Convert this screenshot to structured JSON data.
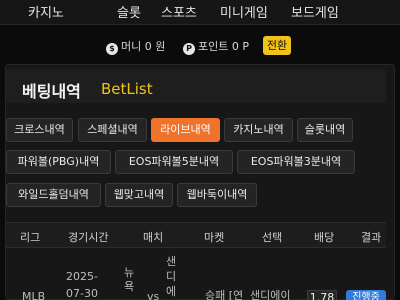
{
  "top_nav": [
    "카지노",
    "슬롯",
    "스포츠",
    "미니게임",
    "보드게임"
  ],
  "money": {
    "money_icon": "$",
    "money_label": "머니 0 원",
    "point_icon": "P",
    "point_label": "포인트 0 P",
    "exchange_label": "전환"
  },
  "page": {
    "title": "베팅내역",
    "subtitle": "BetList"
  },
  "tabs": [
    {
      "label": "크로스내역"
    },
    {
      "label": "스페셜내역"
    },
    {
      "label": "라이브내역",
      "active": true
    },
    {
      "label": "카지노내역"
    },
    {
      "label": "슬롯내역"
    },
    {
      "label": "파워볼(PBG)내역"
    },
    {
      "label": "EOS파워볼5분내역"
    },
    {
      "label": "EOS파워볼3분내역"
    },
    {
      "label": "와일드홀덤내역"
    },
    {
      "label": "웹맞고내역"
    },
    {
      "label": "웹바둑이내역"
    }
  ],
  "table": {
    "headers": [
      "리그",
      "경기시간",
      "매치",
      "마켓",
      "선택",
      "배당",
      "결과"
    ],
    "row": {
      "league": "MLB",
      "time_line1": "2025-",
      "time_line2": "07-30",
      "home_line1": "뉴",
      "home_line2": "욕",
      "vs": "vs",
      "away_line1": "샌",
      "away_line2": "디",
      "away_line3": "에",
      "market": "승패 [연",
      "selection": "샌디에이",
      "odds": "1.78",
      "status": "진행중"
    }
  }
}
